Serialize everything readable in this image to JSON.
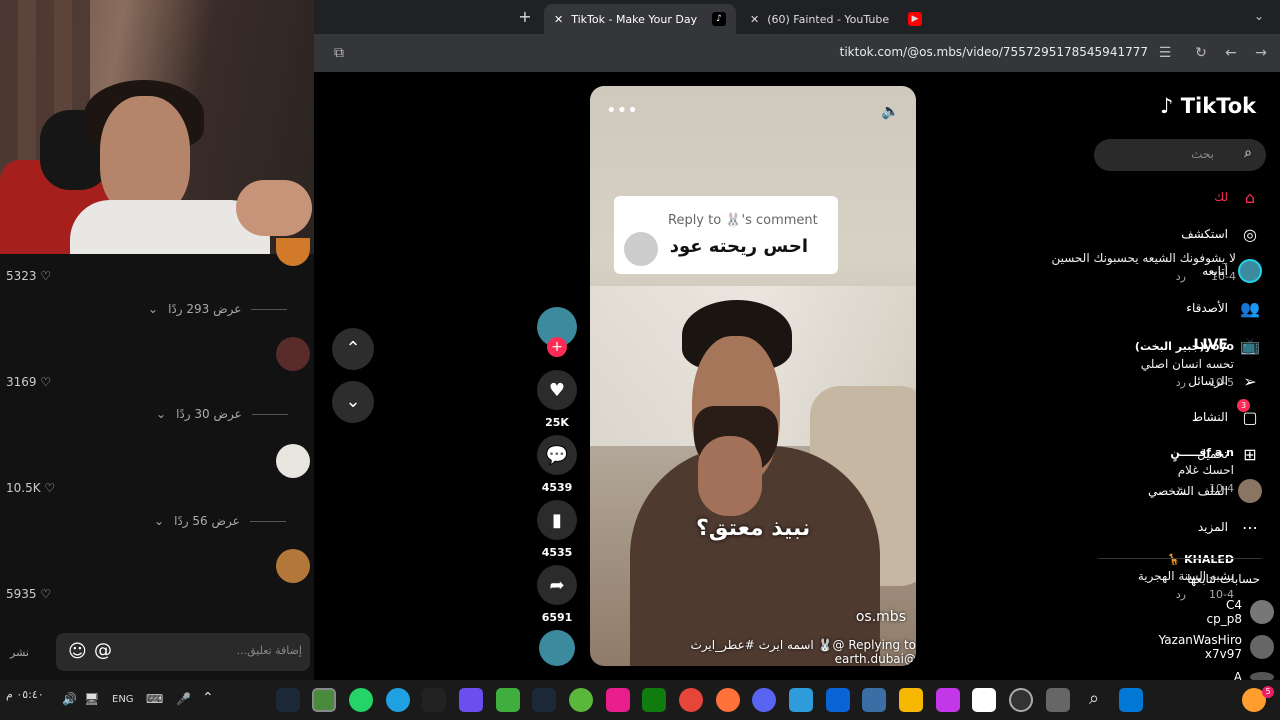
{
  "browser": {
    "tabs": [
      {
        "title": "TikTok - Make Your Day",
        "active": true
      },
      {
        "title": "(60) Fainted - YouTube",
        "active": false
      }
    ],
    "url": "tiktok.com/@os.mbs/video/7557295178545941777"
  },
  "comments": {
    "items": [
      {
        "text": "لا يشوفونك الشيعه يحسبونك الحسين",
        "date": "10-4",
        "reply": "رد",
        "likes": "5323",
        "more": "عرض 293 ردًا"
      },
      {
        "name": "yoyo(جبير البخت)",
        "text": "تحسه انسان اصلي",
        "date": "10-5",
        "reply": "رد",
        "likes": "3169",
        "more": "عرض 30 ردًا"
      },
      {
        "name": "f a nفـــــنٍ",
        "text": "احسك غلام",
        "date": "10-4",
        "reply": "رد",
        "likes": "10.5K",
        "more": "عرض 56 ردًا"
      },
      {
        "name": "KHALED 🦒",
        "text": "يشبه السنة الهجرية",
        "date": "10-4",
        "reply": "رد",
        "likes": "5935"
      }
    ],
    "input_placeholder": "إضافة تعليق...",
    "post_label": "نشر"
  },
  "video": {
    "reply_label": "Reply to 🐰's comment",
    "reply_text": "احس ريحته عود",
    "subtitle": "نبيذ معتق؟",
    "username": "os.mbs",
    "caption": "Replying to @🐰 اسمه ايرث #عطر_ايرث @earth.dubai"
  },
  "actions": {
    "likes": "25K",
    "comments": "4539",
    "saves": "4535",
    "shares": "6591"
  },
  "sidebar": {
    "logo": "TikTok",
    "search_placeholder": "بحث",
    "nav": [
      {
        "label": "لك",
        "icon": "home-icon"
      },
      {
        "label": "استكشف",
        "icon": "compass-icon"
      },
      {
        "label": "أتابعه",
        "icon": "following-avatar"
      },
      {
        "label": "الأصدقاء",
        "icon": "friends-icon"
      },
      {
        "label": "LIVE",
        "icon": "live-icon"
      },
      {
        "label": "الرسائل",
        "icon": "send-icon"
      },
      {
        "label": "النشاط",
        "icon": "activity-icon",
        "badge": "3"
      },
      {
        "label": "تحميل",
        "icon": "upload-icon"
      },
      {
        "label": "الملف الشخصي",
        "icon": "profile-avatar"
      },
      {
        "label": "المزيد",
        "icon": "more-icon"
      }
    ],
    "following_title": "حسابات تتابعها",
    "accounts": [
      {
        "name": "C4",
        "handle": "cp_p8"
      },
      {
        "name": "YazanWasHiro",
        "handle": "x7v97"
      },
      {
        "name": "A",
        "handle": ""
      }
    ]
  },
  "taskbar": {
    "lang": "ENG",
    "time": "٠٥:٤٠ م",
    "notif_badge": "5"
  },
  "colors": {
    "accent": "#fe2c55",
    "bg": "#000000"
  }
}
